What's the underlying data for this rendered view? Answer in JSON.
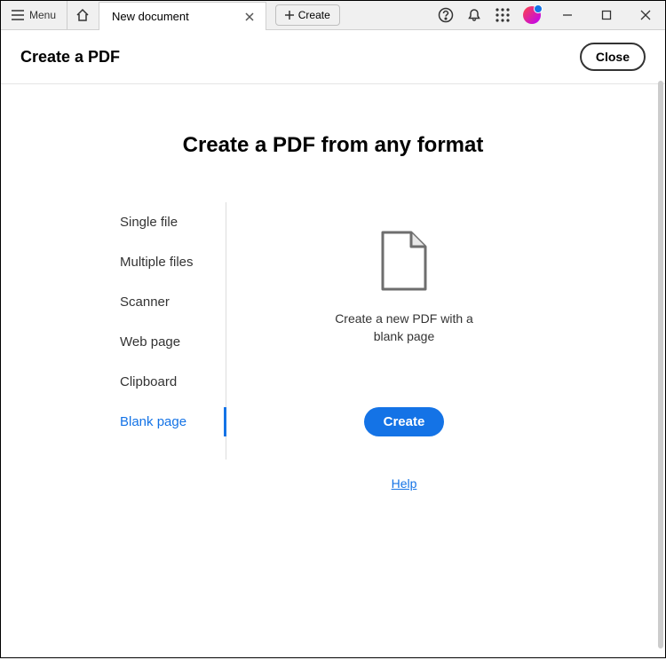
{
  "titlebar": {
    "menu_label": "Menu",
    "tab_title": "New document",
    "create_label": "Create"
  },
  "subheader": {
    "title": "Create a PDF",
    "close_label": "Close"
  },
  "main": {
    "headline": "Create a PDF from any format",
    "sidebar": [
      {
        "label": "Single file",
        "active": false
      },
      {
        "label": "Multiple files",
        "active": false
      },
      {
        "label": "Scanner",
        "active": false
      },
      {
        "label": "Web page",
        "active": false
      },
      {
        "label": "Clipboard",
        "active": false
      },
      {
        "label": "Blank page",
        "active": true
      }
    ],
    "description": "Create a new PDF with a blank page",
    "primary_button": "Create",
    "help_label": "Help"
  }
}
